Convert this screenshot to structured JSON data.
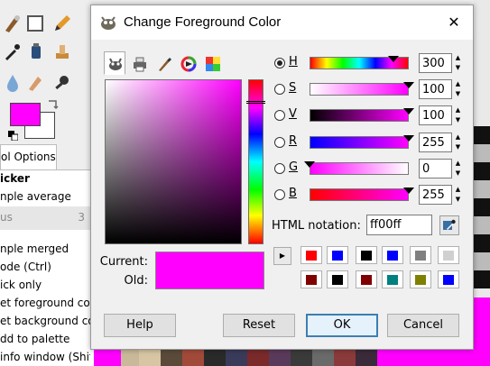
{
  "toolbox": {
    "tab_label": "ol Options",
    "picker_title": "icker",
    "sample_average": "nple average",
    "radius_label": "us",
    "radius_value": "3",
    "options": [
      "nple merged",
      "ode  (Ctrl)",
      "ick only",
      "et foreground color",
      "et background color",
      "dd to palette",
      " info window  (Shift)"
    ],
    "foreground_color": "#ff00ff",
    "background_color": "#ffffff"
  },
  "dialog": {
    "title": "Change Foreground Color",
    "close_glyph": "✕",
    "selector_tabs": [
      "gimp-selector-icon",
      "cmyk-printer-icon",
      "watercolor-brush-icon",
      "color-wheel-icon",
      "scales-icon"
    ],
    "current_label": "Current:",
    "old_label": "Old:",
    "current_color": "#ff00ff",
    "old_color": "#ff00ff",
    "channels": [
      {
        "letter": "H",
        "value": "300",
        "checked": true
      },
      {
        "letter": "S",
        "value": "100",
        "checked": false
      },
      {
        "letter": "V",
        "value": "100",
        "checked": false
      },
      {
        "letter": "R",
        "value": "255",
        "checked": false
      },
      {
        "letter": "G",
        "value": "0",
        "checked": false
      },
      {
        "letter": "B",
        "value": "255",
        "checked": false
      }
    ],
    "html_label": "HTML notation:",
    "html_value": "ff00ff",
    "history_toggle_glyph": "▶",
    "history_colors": [
      [
        "#ff0000",
        "#0000ff",
        "#000000",
        "#0000ff",
        "#808080",
        "#d0d0d0"
      ],
      [
        "#800000",
        "#000000",
        "#800000",
        "#008080",
        "#808000",
        "#0000ff"
      ]
    ],
    "buttons": {
      "help": "Help",
      "reset": "Reset",
      "ok": "OK",
      "cancel": "Cancel"
    }
  }
}
